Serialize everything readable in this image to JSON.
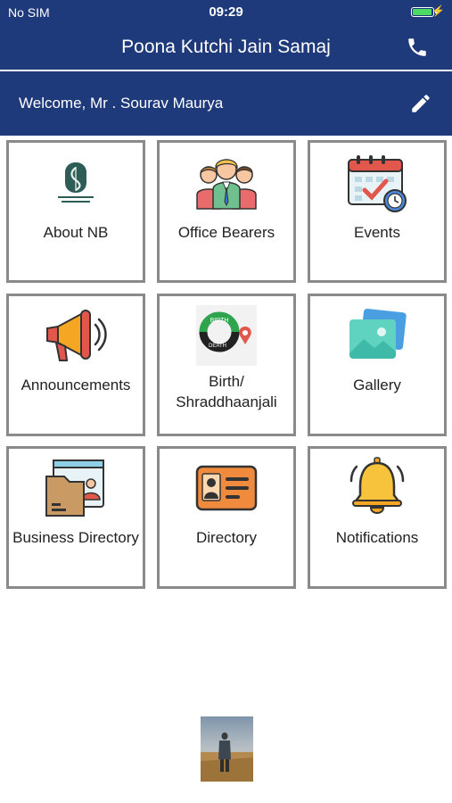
{
  "status_bar": {
    "carrier": "No SIM",
    "time": "09:29",
    "battery_level": 0.95
  },
  "header": {
    "title": "Poona Kutchi Jain Samaj",
    "call_icon": "phone-icon"
  },
  "welcome": {
    "text": "Welcome, Mr . Sourav Maurya",
    "edit_icon": "pencil-icon"
  },
  "tiles": [
    {
      "label": "About NB",
      "icon": "logo-icon"
    },
    {
      "label": "Office Bearers",
      "icon": "people-group-icon"
    },
    {
      "label": "Events",
      "icon": "calendar-icon"
    },
    {
      "label": "Announcements",
      "icon": "megaphone-icon"
    },
    {
      "label": "Birth/ Shraddhaanjali",
      "icon": "birth-death-icon",
      "badge_top": "BIRTH",
      "badge_bottom": "DEATH"
    },
    {
      "label": "Gallery",
      "icon": "photos-icon"
    },
    {
      "label": "Business Directory",
      "icon": "business-card-icon"
    },
    {
      "label": "Directory",
      "icon": "id-card-icon"
    },
    {
      "label": "Notifications",
      "icon": "bell-icon"
    }
  ],
  "colors": {
    "primary": "#1f3a7a",
    "tile_border": "#8a8a8a"
  }
}
